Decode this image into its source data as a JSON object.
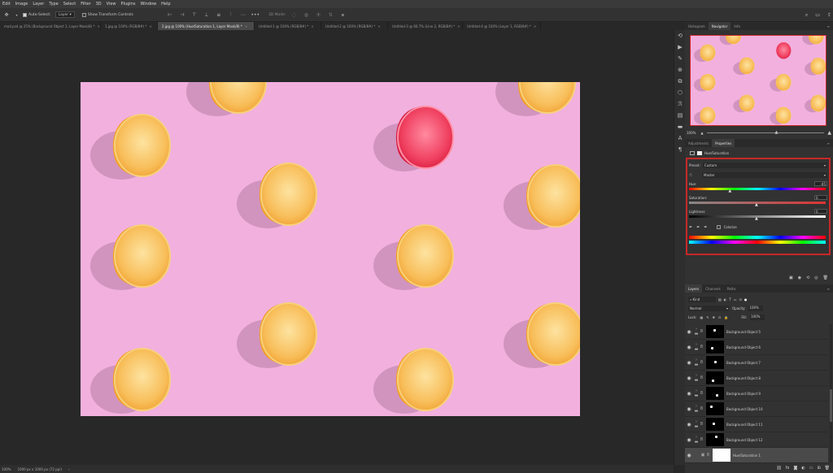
{
  "menu": [
    "Edit",
    "Image",
    "Layer",
    "Type",
    "Select",
    "Filter",
    "3D",
    "View",
    "Plugins",
    "Window",
    "Help"
  ],
  "options": {
    "auto_select_label": "Auto-Select:",
    "auto_select_value": "Layer",
    "transform_label": "Show Transform Controls",
    "mode_3d": "3D Mode:"
  },
  "tabs": [
    {
      "label": "mod.psd @ 25% (Background Object 1, Layer Mask/8) *",
      "active": false
    },
    {
      "label": "1.jpg @ 100% (RGB/8#) *",
      "active": false
    },
    {
      "label": "2.jpg @ 100% (Hue/Saturation 1, Layer Mask/8) *",
      "active": true
    },
    {
      "label": "Untitled-1 @ 100% (RGB/8#) *",
      "active": false
    },
    {
      "label": "Untitled-2 @ 100% (RGB/8#) *",
      "active": false
    },
    {
      "label": "Untitled-3 @ 66.7% (Line 2, RGB/8#) *",
      "active": false
    },
    {
      "label": "Untitled-4 @ 100% (Layer 1, RGB/8#) *",
      "active": false
    }
  ],
  "status": {
    "zoom": "100%",
    "doc_size": "1000 px x 1000 px (72 ppi)"
  },
  "navigator": {
    "tabs": [
      "Histogram",
      "Navigator",
      "Info"
    ],
    "active_tab": "Navigator",
    "zoom": "100%"
  },
  "properties": {
    "tabs": [
      "Adjustments",
      "Properties"
    ],
    "active_tab": "Properties",
    "title": "Hue/Saturation",
    "preset_label": "Preset:",
    "preset_value": "Custom",
    "channel": "Master",
    "hue_label": "Hue:",
    "hue_value": "-45",
    "hue_level": 0.3,
    "saturation_label": "Saturation:",
    "saturation_value": "0",
    "lightness_label": "Lightness:",
    "lightness_value": "0",
    "colorize_label": "Colorize",
    "highlight_color": "#c8282d"
  },
  "layers_panel": {
    "tabs": [
      "Layers",
      "Channels",
      "Paths"
    ],
    "active_tab": "Layers",
    "filter_kind": "Kind",
    "blend_mode": "Normal",
    "opacity_label": "Opacity:",
    "opacity_value": "100%",
    "lock_label": "Lock:",
    "fill_label": "Fill:",
    "fill_value": "100%",
    "layers": [
      {
        "name": "Background Object 5"
      },
      {
        "name": "Background Object 6"
      },
      {
        "name": "Background Object 7"
      },
      {
        "name": "Background Object 8"
      },
      {
        "name": "Background Object 9"
      },
      {
        "name": "Background Object 10"
      },
      {
        "name": "Background Object 11"
      },
      {
        "name": "Background Object 12"
      },
      {
        "name": "Hue/Saturation 1"
      }
    ]
  },
  "colors": {
    "canvas_bg": "#f2b0de",
    "orange": "#f5a623",
    "orange_flesh": "#fbc86a",
    "red_slice": "#e8284a",
    "ui_dark": "#282828"
  }
}
